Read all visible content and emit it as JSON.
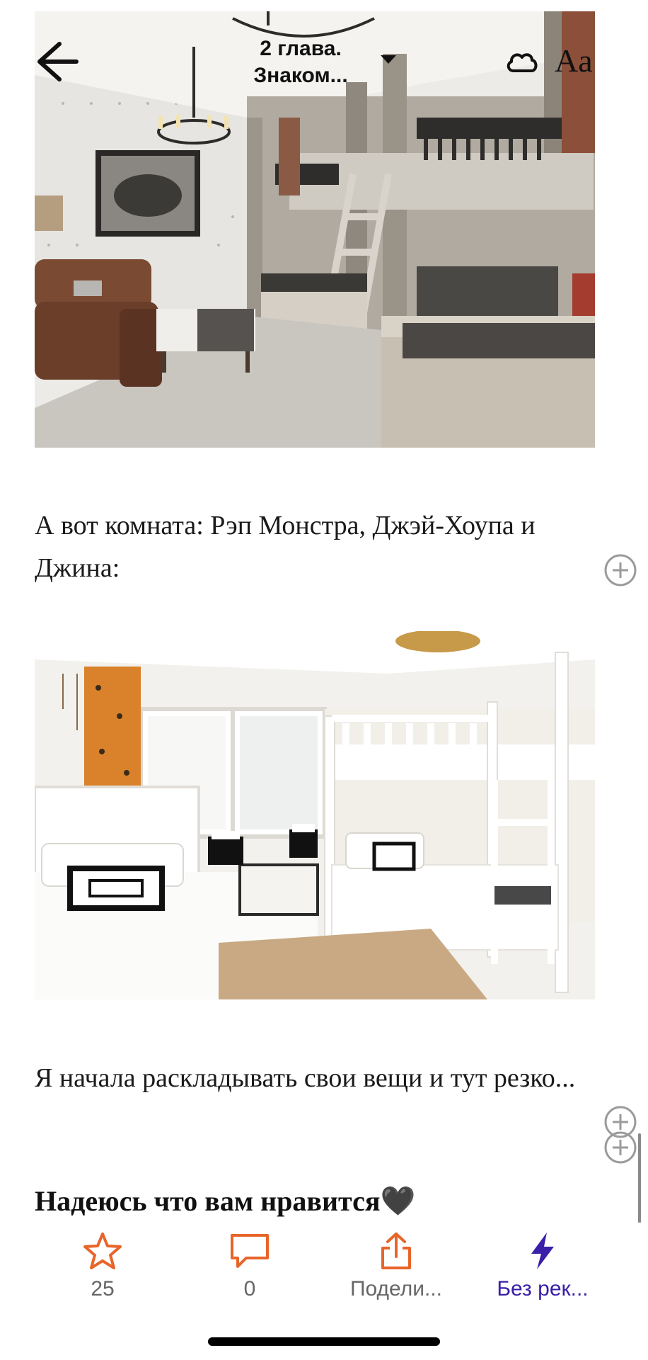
{
  "header": {
    "chapter_title_line1": "2 глава.",
    "chapter_title_line2": "Знаком..."
  },
  "content": {
    "paragraph1": "А вот комната: Рэп Монстра, Джэй-Хоупа и Джина:",
    "paragraph2": "Я начала раскладывать свои вещи и тут резко...",
    "closing_line": "Надеюсь что вам нравится🖤"
  },
  "actions": {
    "vote_count": "25",
    "comment_count": "0",
    "share_label": "Подели...",
    "no_ads_label": "Без рек..."
  },
  "colors": {
    "accent_orange": "#e8652a",
    "accent_purple": "#3a1fa8"
  },
  "icons": {
    "back": "arrow-left-icon",
    "chapter_menu": "caret-down-icon",
    "offline": "cloud-icon",
    "text_settings": "font-size-icon",
    "inline_comment": "plus-circle-icon",
    "vote": "star-icon",
    "comment": "speech-bubble-icon",
    "share": "share-icon",
    "no_ads": "lightning-icon"
  }
}
